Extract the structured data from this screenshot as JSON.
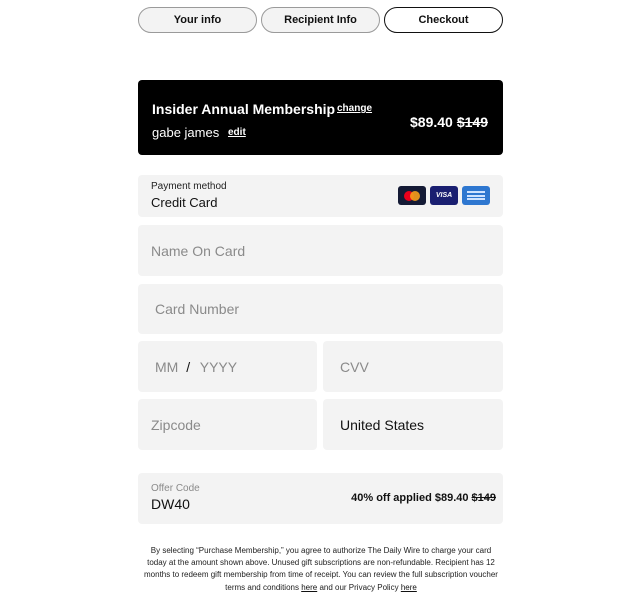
{
  "steps": [
    {
      "label": "Your info",
      "active": false
    },
    {
      "label": "Recipient Info",
      "active": false
    },
    {
      "label": "Checkout",
      "active": true
    }
  ],
  "membership": {
    "title": "Insider Annual Membership",
    "change_link": "change",
    "customer_name": "gabe james",
    "edit_link": "edit",
    "price": "$89.40",
    "original_price": "$149"
  },
  "payment": {
    "label": "Payment method",
    "value": "Credit Card",
    "card_icons": [
      "mastercard-icon",
      "visa-icon",
      "amex-icon"
    ],
    "visa_text": "VISA"
  },
  "form": {
    "name_placeholder": "Name On Card",
    "card_number_placeholder": "Card Number",
    "month_placeholder": "MM",
    "slash": "/",
    "year_placeholder": "YYYY",
    "cvv_placeholder": "CVV",
    "zip_placeholder": "Zipcode",
    "country_value": "United States"
  },
  "offer": {
    "label": "Offer Code",
    "code": "DW40",
    "applied_text": "40% off applied $89.40",
    "original_price": "$149"
  },
  "disclaimer": {
    "text": "By selecting “Purchase Membership,” you agree to authorize The Daily Wire to charge your card today at the amount shown above. Unused gift subscriptions are non-refundable. Recipient has 12 months to redeem gift membership from time of receipt. You can review the full subscription voucher terms and conditions ",
    "here_link_1": "here",
    "middle_text": " and our Privacy Policy ",
    "here_link_2": "here"
  },
  "colors": {
    "membership_bg": "#000000",
    "field_bg": "#f3f3f3",
    "placeholder": "#8a8a8a"
  }
}
